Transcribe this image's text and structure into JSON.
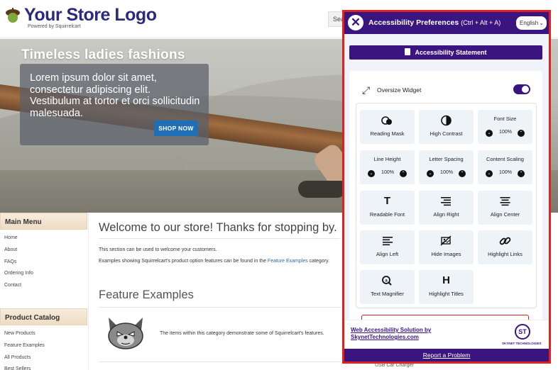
{
  "store": {
    "logo_title": "Your Store Logo",
    "logo_subtitle": "Powered by Squirrelcart",
    "search_text": "Sear",
    "hero": {
      "title": "Timeless ladies fashions",
      "text": "Lorem ipsum dolor sit amet, consectetur adipiscing elit. Vestibulum at tortor et orci sollicitudin malesuada.",
      "button": "SHOP NOW"
    },
    "main_menu": {
      "heading": "Main Menu",
      "items": [
        "Home",
        "About",
        "FAQs",
        "Ordering Info",
        "Contact"
      ]
    },
    "catalog": {
      "heading": "Product Catalog",
      "items": [
        "New Products",
        "Feature Examples",
        "All Products",
        "Best Sellers"
      ]
    },
    "welcome_title": "Welcome to our store! Thanks for stopping by.",
    "welcome_p1": "This section can be used to welcome your customers.",
    "welcome_p2_before": "Examples showing Squirrelcart's product option features can be found in the ",
    "welcome_p2_link": "Feature Examples",
    "welcome_p2_after": " category.",
    "feature_title": "Feature Examples",
    "feature_text": "The items within this category demonstrate some of Squirrelcart's features.",
    "bottom_item": "USB Car Charger"
  },
  "accessibility": {
    "title": "Accessibility Preferences",
    "shortcut": "(Ctrl + Alt + A)",
    "language": "English",
    "statement_button": "Accessibility Statement",
    "oversize_label": "Oversize Widget",
    "oversize_on": true,
    "tiles": [
      {
        "label": "Reading Mask",
        "icon": "reading-mask-icon"
      },
      {
        "label": "High Contrast",
        "icon": "contrast-icon"
      },
      {
        "label": "Font Size",
        "value": "100%"
      },
      {
        "label": "Line Height",
        "value": "100%"
      },
      {
        "label": "Letter Spacing",
        "value": "100%"
      },
      {
        "label": "Content Scaling",
        "value": "100%"
      },
      {
        "label": "Readable Font",
        "icon": "T"
      },
      {
        "label": "Align Right",
        "icon": "align-right-icon"
      },
      {
        "label": "Align Center",
        "icon": "align-center-icon"
      },
      {
        "label": "Align Left",
        "icon": "align-left-icon"
      },
      {
        "label": "Hide Images",
        "icon": "hide-images-icon"
      },
      {
        "label": "Highlight Links",
        "icon": "link-icon"
      },
      {
        "label": "Text Magnifier",
        "icon": "magnifier-icon"
      },
      {
        "label": "Highlight Titles",
        "icon": "H"
      }
    ],
    "footer_link": "Web Accessibility Solution by SkynetTechnologies.com",
    "footer_logo_text": "ST",
    "footer_brand": "SKYNET TECHNOLOGIES",
    "report_problem": "Report a Problem",
    "colors": {
      "brand": "#3a1580",
      "frame": "#e0211d"
    }
  }
}
